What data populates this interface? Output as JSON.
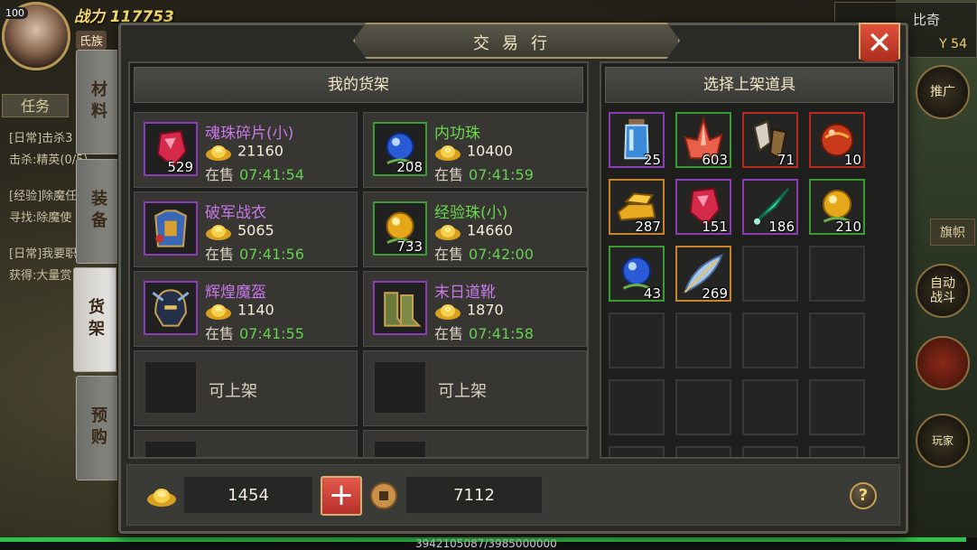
{
  "hud": {
    "level": "100",
    "power": "战力 117753",
    "clan": "氏族",
    "task_tab": "任务",
    "tasks": [
      "[日常]击杀3",
      "击杀:精英(0/5)",
      "[经验]除魔任",
      "寻找:除魔使",
      "[日常]我要职",
      "获得:大量赏"
    ],
    "map_name": "比奇",
    "coord": "Y 54",
    "right_buttons": [
      "推广",
      "自动\n战斗",
      "玩家"
    ],
    "right_tab": "旗帜",
    "exp_text": "3942105087/3985000000",
    "exp_fraction": 0.989
  },
  "dialog": {
    "title": "交易行",
    "close_icon": "close-icon",
    "side_tabs": [
      {
        "label": "材料",
        "active": false
      },
      {
        "label": "装备",
        "active": false
      },
      {
        "label": "货架",
        "active": true
      },
      {
        "label": "预购",
        "active": false
      }
    ],
    "shelf": {
      "title": "我的货架",
      "items": [
        {
          "name": "魂珠碎片(小)",
          "qty": "529",
          "price": "21160",
          "status": "在售",
          "time": "07:41:54",
          "rarity": "purple",
          "icon": "red-gem-shard-icon"
        },
        {
          "name": "内功珠",
          "qty": "208",
          "price": "10400",
          "status": "在售",
          "time": "07:41:59",
          "rarity": "green",
          "icon": "blue-orb-icon"
        },
        {
          "name": "破军战衣",
          "qty": "",
          "price": "5065",
          "status": "在售",
          "time": "07:41:56",
          "rarity": "purple",
          "icon": "armor-icon"
        },
        {
          "name": "经验珠(小)",
          "qty": "733",
          "price": "14660",
          "status": "在售",
          "time": "07:42:00",
          "rarity": "green",
          "icon": "gold-orb-icon"
        },
        {
          "name": "辉煌魔盔",
          "qty": "",
          "price": "1140",
          "status": "在售",
          "time": "07:41:55",
          "rarity": "purple",
          "icon": "helmet-icon"
        },
        {
          "name": "末日道靴",
          "qty": "",
          "price": "1870",
          "status": "在售",
          "time": "07:41:58",
          "rarity": "purple",
          "icon": "boots-icon"
        }
      ],
      "empty_label": "可上架"
    },
    "inventory": {
      "title": "选择上架道具",
      "items": [
        {
          "qty": "25",
          "icon": "blue-potion-icon",
          "rarity": "purple"
        },
        {
          "qty": "603",
          "icon": "red-crystal-icon",
          "rarity": "green"
        },
        {
          "qty": "71",
          "icon": "scroll-fragment-icon",
          "rarity": "red"
        },
        {
          "qty": "10",
          "icon": "red-orb-icon",
          "rarity": "red"
        },
        {
          "qty": "287",
          "icon": "gold-bar-icon",
          "rarity": "orange"
        },
        {
          "qty": "151",
          "icon": "red-gem-shard-icon",
          "rarity": "purple"
        },
        {
          "qty": "186",
          "icon": "jade-dart-icon",
          "rarity": "purple"
        },
        {
          "qty": "210",
          "icon": "gold-orb-icon",
          "rarity": "green"
        },
        {
          "qty": "43",
          "icon": "blue-orb-icon",
          "rarity": "green"
        },
        {
          "qty": "269",
          "icon": "feather-icon",
          "rarity": "orange"
        }
      ]
    },
    "footer": {
      "ingot_amount": "1454",
      "coin_amount": "7112",
      "plus_icon": "plus-icon",
      "help_icon": "help-icon",
      "help_label": "?"
    },
    "colors": {
      "purple": "#8a3cb4",
      "green": "#3c9a34",
      "red": "#b8281c",
      "orange": "#c8822c",
      "name_purple": "#c878e8",
      "name_green": "#6ad84e",
      "time_green": "#64d24e"
    }
  }
}
